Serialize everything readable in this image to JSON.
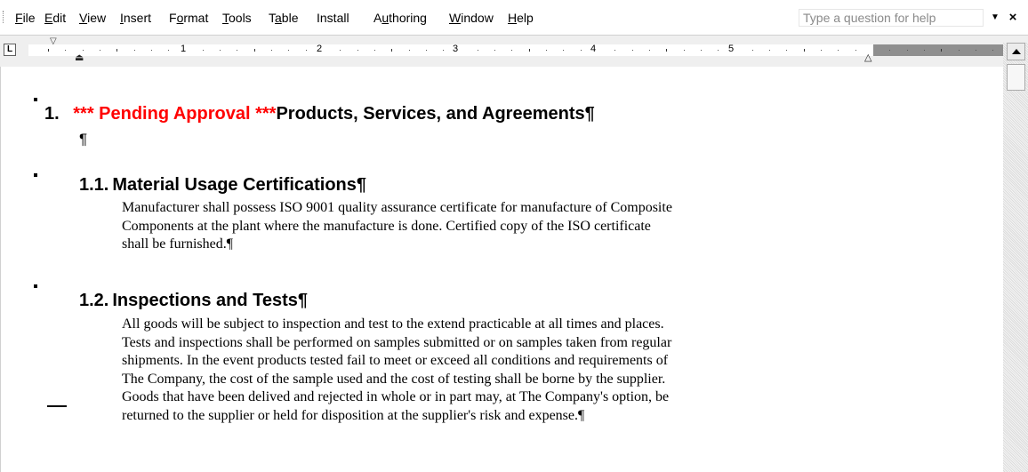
{
  "menu": {
    "items": [
      {
        "label": "File"
      },
      {
        "label": "Edit"
      },
      {
        "label": "View"
      },
      {
        "label": "Insert"
      },
      {
        "label": "Format"
      },
      {
        "label": "Tools"
      },
      {
        "label": "Table"
      },
      {
        "label": "Install"
      },
      {
        "label": "Authoring"
      },
      {
        "label": "Window"
      },
      {
        "label": "Help"
      }
    ],
    "ask_placeholder": "Type a question for help",
    "ask_arrow": "▼",
    "close": "×"
  },
  "ruler": {
    "tab_selector": "L",
    "numbers": [
      "1",
      "2",
      "3",
      "4",
      "5"
    ]
  },
  "document": {
    "heading1": {
      "number": "1.",
      "status": "*** Pending Approval ***",
      "title": "Products,  Services, and Agreements¶"
    },
    "empty_para": "¶",
    "sections": [
      {
        "number": "1.1.",
        "title": "Material Usage Certifications¶",
        "lines": [
          "Manufacturer shall possess ISO 9001 quality assurance certificate for manufacture of Composite",
          "Components at the plant where the manufacture is done. Certified copy of the ISO certificate",
          "shall be furnished.¶"
        ]
      },
      {
        "number": "1.2.",
        "title": "Inspections and Tests¶",
        "lines": [
          "All goods will be subject to inspection and test to the extend practicable at all times and places.",
          "Tests and inspections shall be performed on samples submitted or on samples taken from regular",
          "shipments.  In the event products tested fail to meet or exceed all conditions and requirements of",
          "The Company, the cost of the sample used and the cost of testing shall be borne by the supplier.",
          "Goods that have been delived and rejected in whole or in part may, at The Company's option, be",
          "returned to the supplier or held for disposition at the supplier's risk and expense.¶"
        ]
      }
    ]
  }
}
